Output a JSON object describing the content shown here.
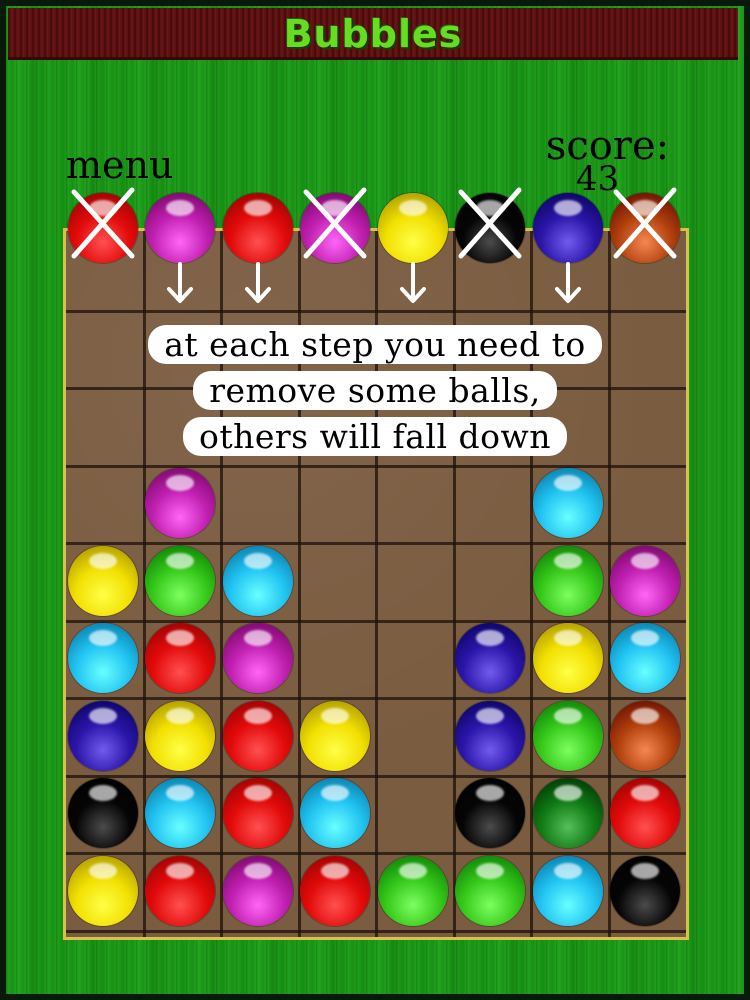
{
  "app": {
    "title": "Bubbles",
    "menu_label": "menu",
    "score_label": "score:",
    "score_value": "43"
  },
  "hint": {
    "lines": [
      "at each step you need to",
      "remove some balls,",
      "others will fall down"
    ]
  },
  "colors": {
    "red": "#e20a0a",
    "magenta": "#c020b0",
    "yellow": "#f2e000",
    "black": "#050505",
    "navy": "#2b15a8",
    "brown": "#b0400c",
    "cyan": "#22c4f2",
    "green": "#36c81a",
    "dark_green": "#0f7a14",
    "board_bg": "#7a5c40",
    "board_border": "#d9c24a",
    "title_bar": "#5e0e0e",
    "title_text": "#66dd22",
    "background_green": "#1ea21a"
  },
  "board": {
    "columns": 8,
    "rows": 9,
    "top_row": [
      {
        "color": "red",
        "removed": true
      },
      {
        "color": "magenta",
        "removed": false
      },
      {
        "color": "red",
        "removed": false
      },
      {
        "color": "magenta",
        "removed": true
      },
      {
        "color": "yellow",
        "removed": false
      },
      {
        "color": "black",
        "removed": true
      },
      {
        "color": "navy",
        "removed": false
      },
      {
        "color": "brown",
        "removed": true
      }
    ],
    "arrow_columns": [
      1,
      2,
      4,
      6
    ],
    "grid": [
      [
        null,
        null,
        null,
        null,
        null,
        null,
        null,
        null
      ],
      [
        null,
        null,
        null,
        null,
        null,
        null,
        null,
        null
      ],
      [
        null,
        null,
        null,
        null,
        null,
        null,
        null,
        null
      ],
      [
        null,
        "magenta",
        null,
        null,
        null,
        null,
        "cyan",
        null
      ],
      [
        "yellow",
        "green",
        "cyan",
        null,
        null,
        null,
        "green",
        "magenta"
      ],
      [
        "cyan",
        "red",
        "magenta",
        null,
        null,
        "navy",
        "yellow",
        "cyan"
      ],
      [
        "navy",
        "yellow",
        "red",
        "yellow",
        null,
        "navy",
        "green",
        "brown"
      ],
      [
        "black",
        "cyan",
        "red",
        "cyan",
        null,
        "black",
        "dark_green",
        "red"
      ],
      [
        "yellow",
        "red",
        "magenta",
        "red",
        "green",
        "green",
        "cyan",
        "black"
      ]
    ]
  }
}
